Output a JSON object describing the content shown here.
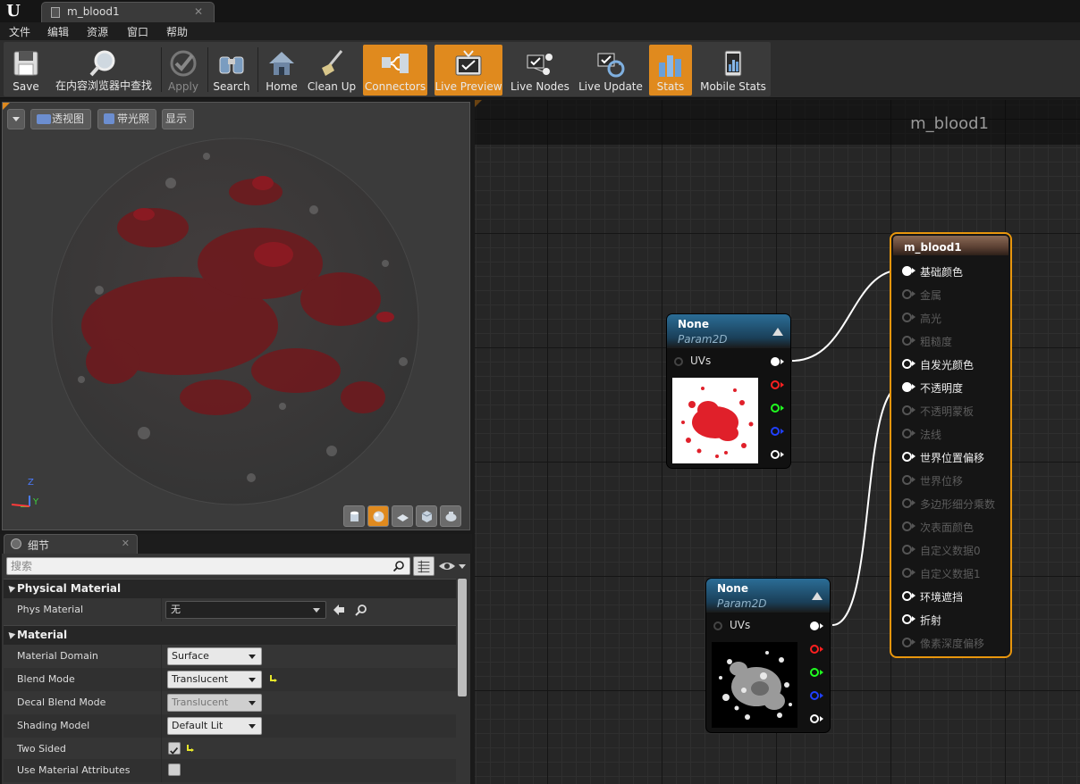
{
  "app": {
    "logo": "U",
    "document_tab": "m_blood1"
  },
  "menu": [
    "文件",
    "编辑",
    "资源",
    "窗口",
    "帮助"
  ],
  "toolbar": [
    {
      "label": "Save",
      "icon": "save-icon",
      "active": false,
      "disabled": false
    },
    {
      "label": "在内容浏览器中查找",
      "icon": "find-in-content-browser-icon",
      "active": false,
      "disabled": false
    },
    {
      "label": "Apply",
      "icon": "apply-icon",
      "active": false,
      "disabled": true
    },
    {
      "label": "Search",
      "icon": "binoculars-icon",
      "active": false,
      "disabled": false
    },
    {
      "label": "Home",
      "icon": "home-icon",
      "active": false,
      "disabled": false
    },
    {
      "label": "Clean Up",
      "icon": "broom-icon",
      "active": false,
      "disabled": false
    },
    {
      "label": "Connectors",
      "icon": "connectors-icon",
      "active": true,
      "disabled": false
    },
    {
      "label": "Live Preview",
      "icon": "live-preview-icon",
      "active": true,
      "disabled": false
    },
    {
      "label": "Live Nodes",
      "icon": "live-nodes-icon",
      "active": false,
      "disabled": false
    },
    {
      "label": "Live Update",
      "icon": "live-update-icon",
      "active": false,
      "disabled": false
    },
    {
      "label": "Stats",
      "icon": "stats-icon",
      "active": true,
      "disabled": false
    },
    {
      "label": "Mobile Stats",
      "icon": "mobile-stats-icon",
      "active": false,
      "disabled": false
    }
  ],
  "viewport": {
    "perspective_label": "透视图",
    "lit_label": "带光照",
    "show_label": "显示",
    "axis_z": "Z",
    "axis_y": "Y"
  },
  "details": {
    "tab_label": "细节",
    "search_placeholder": "搜索",
    "categories": {
      "physical_material": "Physical Material",
      "material": "Material"
    },
    "phys_material": {
      "name": "Phys Material",
      "value": "无"
    },
    "rows": [
      {
        "name": "Material Domain",
        "value": "Surface"
      },
      {
        "name": "Blend Mode",
        "value": "Translucent"
      },
      {
        "name": "Decal Blend Mode",
        "value": "Translucent"
      },
      {
        "name": "Shading Model",
        "value": "Default Lit"
      },
      {
        "name": "Two Sided",
        "checked": true
      },
      {
        "name": "Use Material Attributes",
        "checked": false
      }
    ]
  },
  "graph": {
    "title": "m_blood1",
    "texture_nodes": [
      {
        "title": "None",
        "subtitle": "Param2D",
        "input_label": "UVs"
      },
      {
        "title": "None",
        "subtitle": "Param2D",
        "input_label": "UVs"
      }
    ],
    "result_node": {
      "title": "m_blood1",
      "pins": [
        {
          "label": "基础颜色",
          "enabled": true,
          "connected": true
        },
        {
          "label": "金属",
          "enabled": false,
          "connected": false
        },
        {
          "label": "高光",
          "enabled": false,
          "connected": false
        },
        {
          "label": "粗糙度",
          "enabled": false,
          "connected": false
        },
        {
          "label": "自发光颜色",
          "enabled": true,
          "connected": false
        },
        {
          "label": "不透明度",
          "enabled": true,
          "connected": true
        },
        {
          "label": "不透明蒙板",
          "enabled": false,
          "connected": false
        },
        {
          "label": "法线",
          "enabled": false,
          "connected": false
        },
        {
          "label": "世界位置偏移",
          "enabled": true,
          "connected": false
        },
        {
          "label": "世界位移",
          "enabled": false,
          "connected": false
        },
        {
          "label": "多边形细分乘数",
          "enabled": false,
          "connected": false
        },
        {
          "label": "次表面颜色",
          "enabled": false,
          "connected": false
        },
        {
          "label": "自定义数据0",
          "enabled": false,
          "connected": false
        },
        {
          "label": "自定义数据1",
          "enabled": false,
          "connected": false
        },
        {
          "label": "环境遮挡",
          "enabled": true,
          "connected": false
        },
        {
          "label": "折射",
          "enabled": true,
          "connected": false
        },
        {
          "label": "像素深度偏移",
          "enabled": false,
          "connected": false
        }
      ]
    }
  },
  "colors": {
    "accent": "#e08a1e",
    "node_header": "#2b6d96",
    "result_border": "#e8960d",
    "pin_red": "#ff2020",
    "pin_green": "#20ff20",
    "pin_blue": "#2040ff"
  }
}
